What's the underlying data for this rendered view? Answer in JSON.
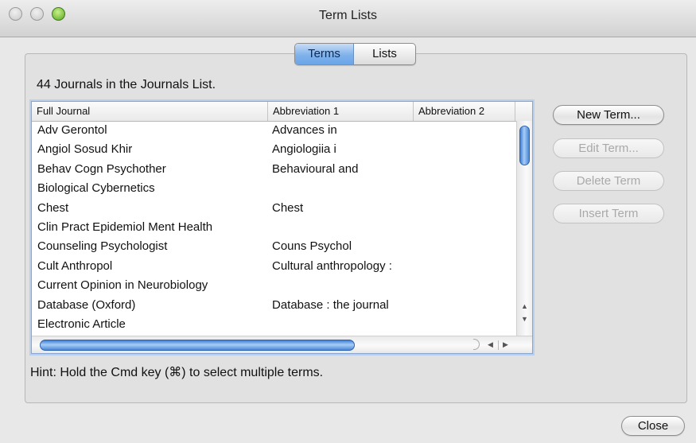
{
  "window": {
    "title": "Term Lists"
  },
  "tabs": {
    "terms_label": "Terms",
    "lists_label": "Lists",
    "active": "Terms"
  },
  "summary": {
    "text": "44 Journals in the Journals List."
  },
  "table": {
    "headers": [
      "Full Journal",
      "Abbreviation 1",
      "Abbreviation 2"
    ],
    "rows": [
      [
        "Adv Gerontol",
        "Advances in",
        ""
      ],
      [
        "Angiol Sosud Khir",
        "Angiologiia i",
        ""
      ],
      [
        "Behav Cogn Psychother",
        "Behavioural and",
        ""
      ],
      [
        "Biological Cybernetics",
        "",
        ""
      ],
      [
        "Chest",
        "Chest",
        ""
      ],
      [
        "Clin Pract Epidemiol Ment Health",
        "",
        ""
      ],
      [
        "Counseling Psychologist",
        "Couns Psychol",
        ""
      ],
      [
        "Cult Anthropol",
        "Cultural anthropology :",
        ""
      ],
      [
        "Current Opinion in Neurobiology",
        "",
        ""
      ],
      [
        "Database (Oxford)",
        "Database : the journal",
        ""
      ],
      [
        "Electronic Article",
        "",
        ""
      ]
    ]
  },
  "buttons": {
    "new_term": "New Term...",
    "edit_term": "Edit Term...",
    "delete_term": "Delete Term",
    "insert_term": "Insert Term",
    "close": "Close"
  },
  "hint": {
    "text": "Hint: Hold the Cmd key (⌘) to select multiple terms."
  },
  "icons": {
    "close": "close-traffic-light-icon",
    "minimize": "minimize-traffic-light-icon",
    "zoom": "zoom-traffic-light-icon",
    "scroll_up": "scroll-up-arrow-icon",
    "scroll_down": "scroll-down-arrow-icon",
    "scroll_left": "scroll-left-arrow-icon",
    "scroll_right": "scroll-right-arrow-icon"
  },
  "colors": {
    "accent": "#7fb2ea",
    "selection_border": "#8aa6cf"
  }
}
